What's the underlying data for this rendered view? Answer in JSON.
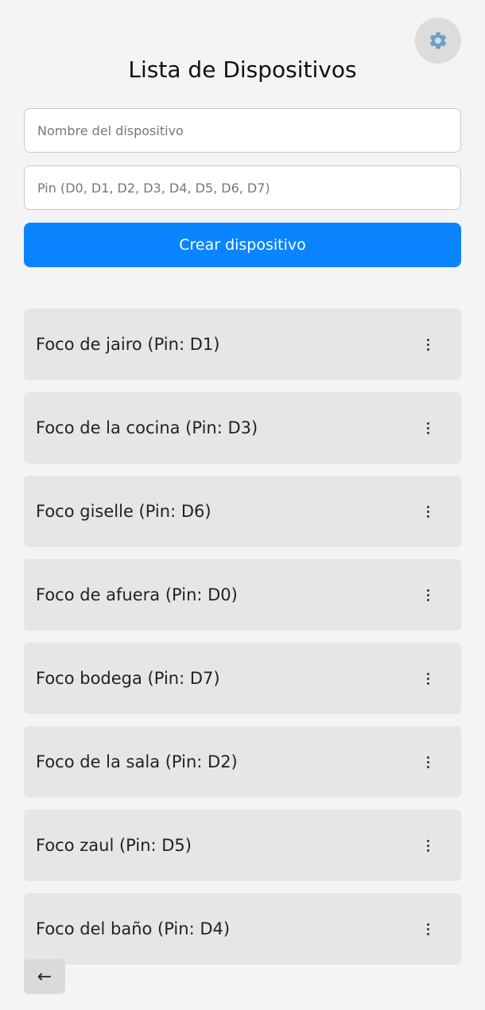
{
  "header": {
    "title": "Lista de Dispositivos",
    "settings_icon": "gear-icon"
  },
  "form": {
    "name_placeholder": "Nombre del dispositivo",
    "name_value": "",
    "pin_placeholder": "Pin (D0, D1, D2, D3, D4, D5, D6, D7)",
    "pin_value": "",
    "create_label": "Crear dispositivo"
  },
  "devices": [
    {
      "label": "Foco de jairo (Pin: D1)"
    },
    {
      "label": "Foco de la cocina (Pin: D3)"
    },
    {
      "label": "Foco giselle (Pin: D6)"
    },
    {
      "label": "Foco de afuera (Pin: D0)"
    },
    {
      "label": "Foco bodega (Pin: D7)"
    },
    {
      "label": "Foco de la sala (Pin: D2)"
    },
    {
      "label": "Foco zaul (Pin: D5)"
    },
    {
      "label": "Foco del baño (Pin: D4)"
    }
  ],
  "footer": {
    "back_label": "←"
  },
  "colors": {
    "background": "#f4f4f4",
    "primary": "#0a84ff",
    "card": "#e6e6e6"
  }
}
